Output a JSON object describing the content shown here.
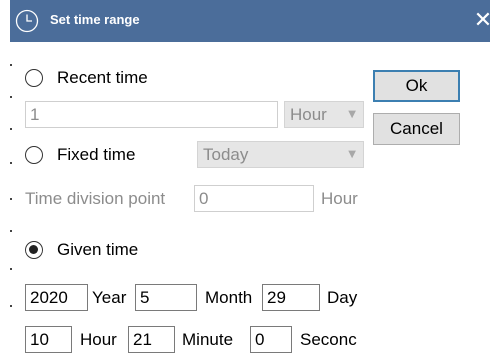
{
  "window": {
    "title": "Set time range",
    "close_glyph": "✕"
  },
  "recent": {
    "label": "Recent time",
    "value": "1",
    "unit_selected": "Hour",
    "selected": false
  },
  "fixed": {
    "label": "Fixed time",
    "day_selected": "Today",
    "selected": false
  },
  "division": {
    "label": "Time division point",
    "value": "0",
    "unit": "Hour"
  },
  "given": {
    "label": "Given time",
    "selected": true,
    "year": "2020",
    "year_label": "Year",
    "month": "5",
    "month_label": "Month",
    "day": "29",
    "day_label": "Day",
    "hour": "10",
    "hour_label": "Hour",
    "minute": "21",
    "minute_label": "Minute",
    "second": "0",
    "second_label": "Seconc"
  },
  "buttons": {
    "ok": "Ok",
    "cancel": "Cancel"
  },
  "colors": {
    "titlebar": "#4b6d9a",
    "default_button_border": "#3c7fb1"
  }
}
